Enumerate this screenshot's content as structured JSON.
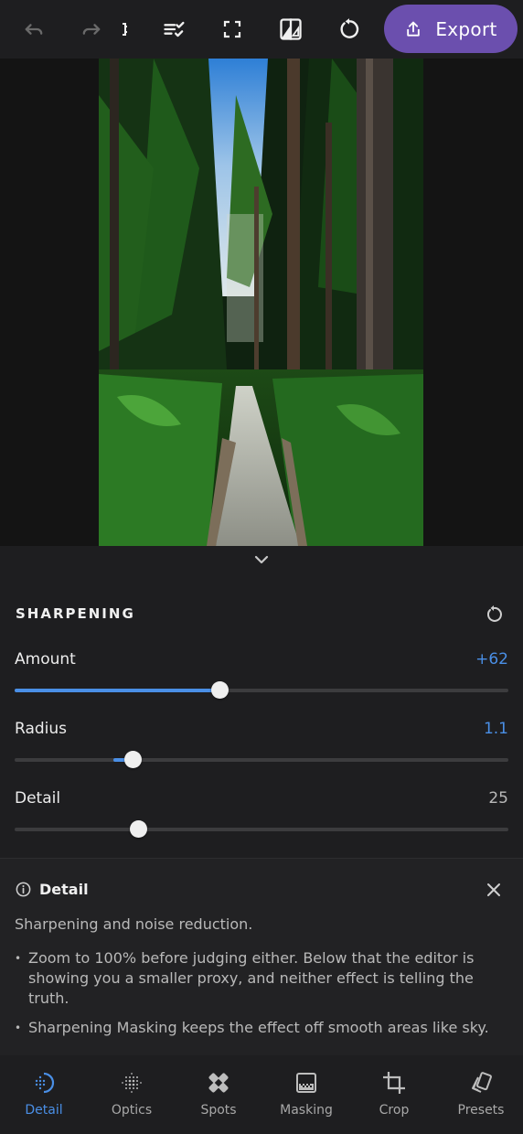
{
  "toolbar": {
    "icons": [
      "undo-icon",
      "redo-icon",
      "compare-icon",
      "checklist-icon",
      "fullscreen-icon",
      "before-after-icon",
      "reset-icon",
      "share-icon"
    ],
    "export_label": "Export",
    "accent": "#6b4fae"
  },
  "section": {
    "title": "SHARPENING"
  },
  "sliders": [
    {
      "label": "Amount",
      "value": "+62",
      "level": 0.415,
      "fill_from": 0.0,
      "value_color": "#4a8fe6"
    },
    {
      "label": "Radius",
      "value": "1.1",
      "level": 0.24,
      "fill_from": 0.2,
      "value_color": "#4a8fe6"
    },
    {
      "label": "Detail",
      "value": "25",
      "level": 0.25,
      "fill_from": 0.25,
      "value_color": "#b9b9b9"
    }
  ],
  "info": {
    "title": "Detail",
    "description": "Sharpening and noise reduction.",
    "bullets": [
      "Zoom to 100% before judging either. Below that the editor is showing you a smaller proxy, and neither effect is telling the truth.",
      "Sharpening Masking keeps the effect off smooth areas like sky."
    ]
  },
  "nav": {
    "items": [
      {
        "label": "Detail",
        "icon": "detail-icon",
        "active": true
      },
      {
        "label": "Optics",
        "icon": "optics-icon",
        "active": false
      },
      {
        "label": "Spots",
        "icon": "spots-icon",
        "active": false
      },
      {
        "label": "Masking",
        "icon": "masking-icon",
        "active": false
      },
      {
        "label": "Crop",
        "icon": "crop-icon",
        "active": false
      },
      {
        "label": "Presets",
        "icon": "presets-icon",
        "active": false
      }
    ],
    "active_color": "#4a8fe6"
  }
}
